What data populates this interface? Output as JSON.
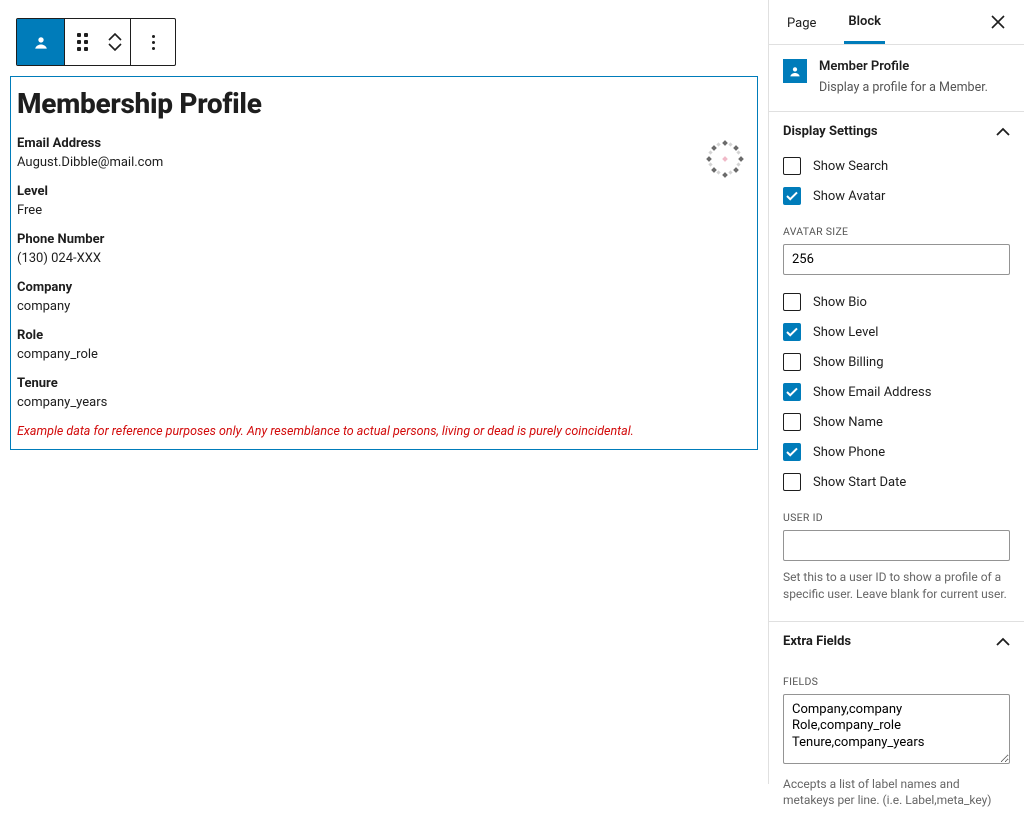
{
  "toolbar": {
    "block_icon": "member-profile-icon"
  },
  "sidebar": {
    "tabs": {
      "page": "Page",
      "block": "Block"
    },
    "block_name": "Member Profile",
    "block_desc": "Display a profile for a Member.",
    "display": {
      "title": "Display Settings",
      "options": [
        {
          "label": "Show Search",
          "checked": false
        },
        {
          "label": "Show Avatar",
          "checked": true
        }
      ],
      "avatar_size_label": "AVATAR SIZE",
      "avatar_size_value": "256",
      "more_options": [
        {
          "label": "Show Bio",
          "checked": false
        },
        {
          "label": "Show Level",
          "checked": true
        },
        {
          "label": "Show Billing",
          "checked": false
        },
        {
          "label": "Show Email Address",
          "checked": true
        },
        {
          "label": "Show Name",
          "checked": false
        },
        {
          "label": "Show Phone",
          "checked": true
        },
        {
          "label": "Show Start Date",
          "checked": false
        }
      ],
      "user_id_label": "USER ID",
      "user_id_value": "",
      "user_id_help": "Set this to a user ID to show a profile of a specific user. Leave blank for current user."
    },
    "extra": {
      "title": "Extra Fields",
      "fields_label": "FIELDS",
      "fields_value": "Company,company\nRole,company_role\nTenure,company_years",
      "fields_help": "Accepts a list of label names and metakeys per line. (i.e. Label,meta_key)"
    }
  },
  "preview": {
    "title": "Membership Profile",
    "fields": [
      {
        "label": "Email Address",
        "value": "August.Dibble@mail.com"
      },
      {
        "label": "Level",
        "value": "Free"
      },
      {
        "label": "Phone Number",
        "value": "(130) 024-XXX"
      },
      {
        "label": "Company",
        "value": "company"
      },
      {
        "label": "Role",
        "value": "company_role"
      },
      {
        "label": "Tenure",
        "value": "company_years"
      }
    ],
    "disclaimer": "Example data for reference purposes only. Any resemblance to actual persons, living or dead is purely coincidental."
  }
}
